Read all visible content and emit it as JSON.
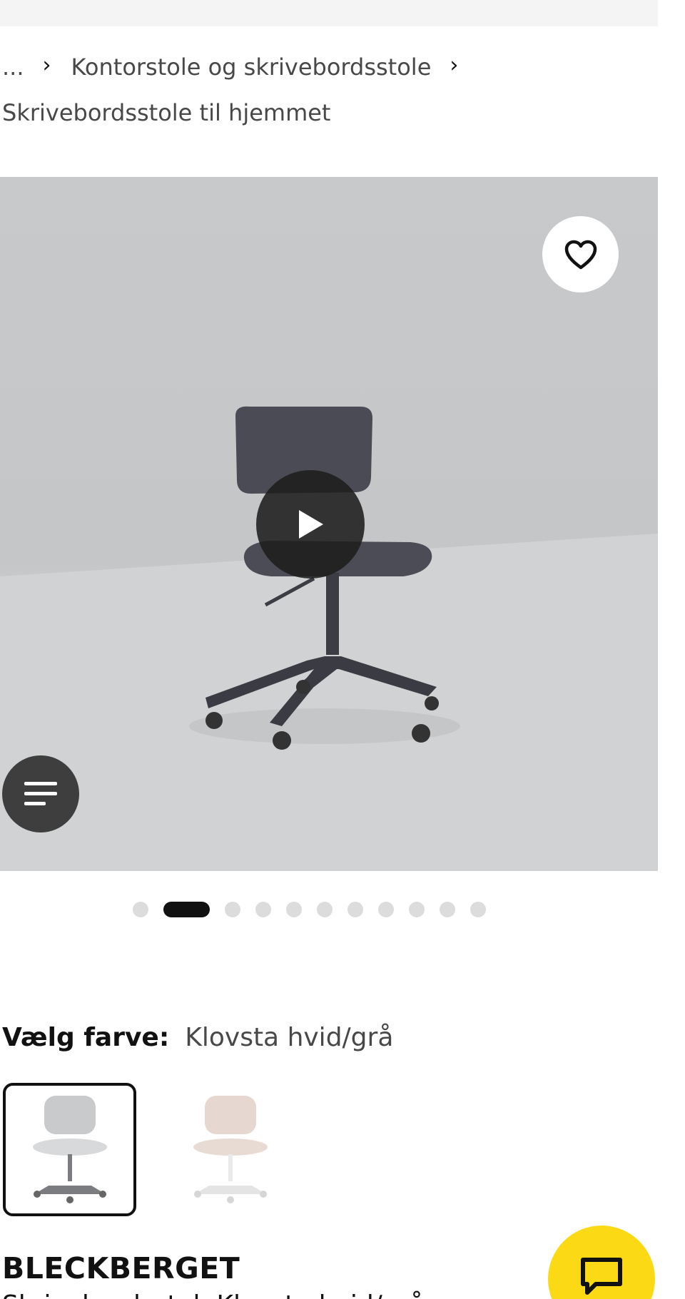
{
  "breadcrumb": {
    "ellipsis": "...",
    "items": [
      "Kontorstole og skrivebordsstole",
      "Skrivebordsstole til hjemmet"
    ],
    "separator_icon": "chevron-right-icon"
  },
  "media": {
    "favorite_icon": "heart-outline-icon",
    "play_icon": "play-icon",
    "info_icon": "text-lines-icon",
    "image_subject": "chair-product-video-thumbnail"
  },
  "carousel": {
    "total": 11,
    "active_index": 1
  },
  "color_picker": {
    "label": "Vælg farve:",
    "selected_value": "Klovsta hvid/grå",
    "options": [
      {
        "name": "Klovsta hvid/grå",
        "selected": true
      },
      {
        "name": "pink/white variant",
        "selected": false
      }
    ]
  },
  "product": {
    "name": "BLECKBERGET",
    "description": "Skrivebordsstol, Klovsta hvid/grå"
  },
  "chat": {
    "icon": "chat-bubble-icon"
  },
  "colors": {
    "top_strip": "#f4f4f4",
    "chat_accent": "#fbd914",
    "active_dot": "#111111",
    "inactive_dot": "#dcdcdc"
  }
}
